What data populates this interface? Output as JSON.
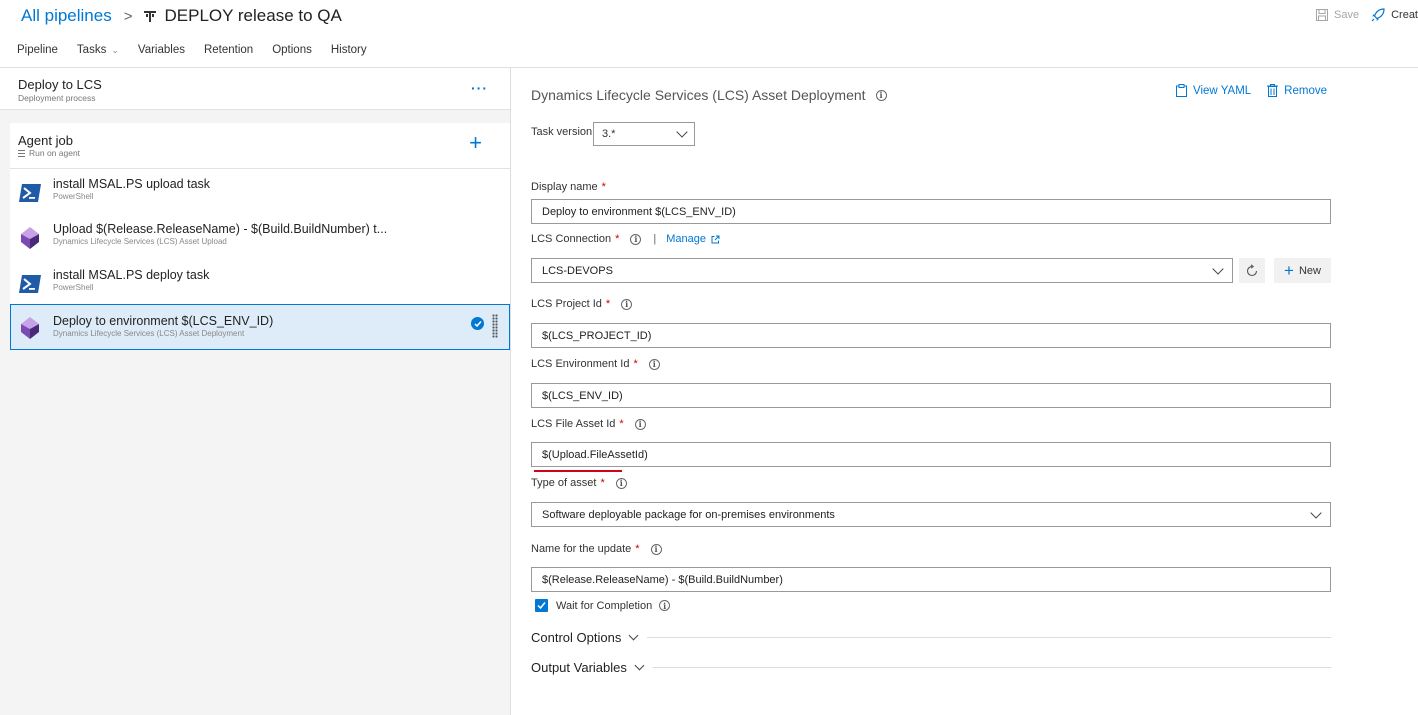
{
  "breadcrumb": {
    "root": "All pipelines",
    "separator": ">",
    "title": "DEPLOY release to QA"
  },
  "header_actions": {
    "save": "Save",
    "create": "Creat"
  },
  "tabs": [
    {
      "label": "Pipeline"
    },
    {
      "label": "Tasks"
    },
    {
      "label": "Variables"
    },
    {
      "label": "Retention"
    },
    {
      "label": "Options"
    },
    {
      "label": "History"
    }
  ],
  "stage": {
    "title": "Deploy to LCS",
    "subtitle": "Deployment process",
    "more": "···"
  },
  "agent_job": {
    "title": "Agent job",
    "subtitle": "Run on agent",
    "add": "+"
  },
  "tasks": [
    {
      "title": "install MSAL.PS upload task",
      "subtitle": "PowerShell",
      "icon": "powershell-icon"
    },
    {
      "title": "Upload $(Release.ReleaseName) - $(Build.BuildNumber) t...",
      "subtitle": "Dynamics Lifecycle Services (LCS) Asset Upload",
      "icon": "lcs-icon"
    },
    {
      "title": "install MSAL.PS deploy task",
      "subtitle": "PowerShell",
      "icon": "powershell-icon"
    },
    {
      "title": "Deploy to environment $(LCS_ENV_ID)",
      "subtitle": "Dynamics Lifecycle Services (LCS) Asset Deployment",
      "icon": "lcs-icon"
    }
  ],
  "panel": {
    "title": "Dynamics Lifecycle Services (LCS) Asset Deployment",
    "view_yaml": "View YAML",
    "remove": "Remove",
    "task_version_label": "Task version",
    "task_version_value": "3.*",
    "display_name_label": "Display name",
    "display_name_value": "Deploy to environment $(LCS_ENV_ID)",
    "lcs_connection_label": "LCS Connection",
    "pipe": "|",
    "manage": "Manage",
    "lcs_connection_value": "LCS-DEVOPS",
    "new_label": "New",
    "project_id_label": "LCS Project Id",
    "project_id_value": "$(LCS_PROJECT_ID)",
    "env_id_label": "LCS Environment Id",
    "env_id_value": "$(LCS_ENV_ID)",
    "file_asset_label": "LCS File Asset Id",
    "file_asset_value": "$(Upload.FileAssetId)",
    "asset_type_label": "Type of asset",
    "asset_type_value": "Software deployable package for on-premises environments",
    "update_name_label": "Name for the update",
    "update_name_value": "$(Release.ReleaseName) - $(Build.BuildNumber)",
    "wait_label": "Wait for Completion",
    "wait_checked": true,
    "control_options": "Control Options",
    "output_variables": "Output Variables",
    "required_mark": "*"
  },
  "colors": {
    "accent": "#0078d4",
    "selected_bg": "#deecf9",
    "required": "#c00000",
    "annotation": "#d0021b"
  }
}
